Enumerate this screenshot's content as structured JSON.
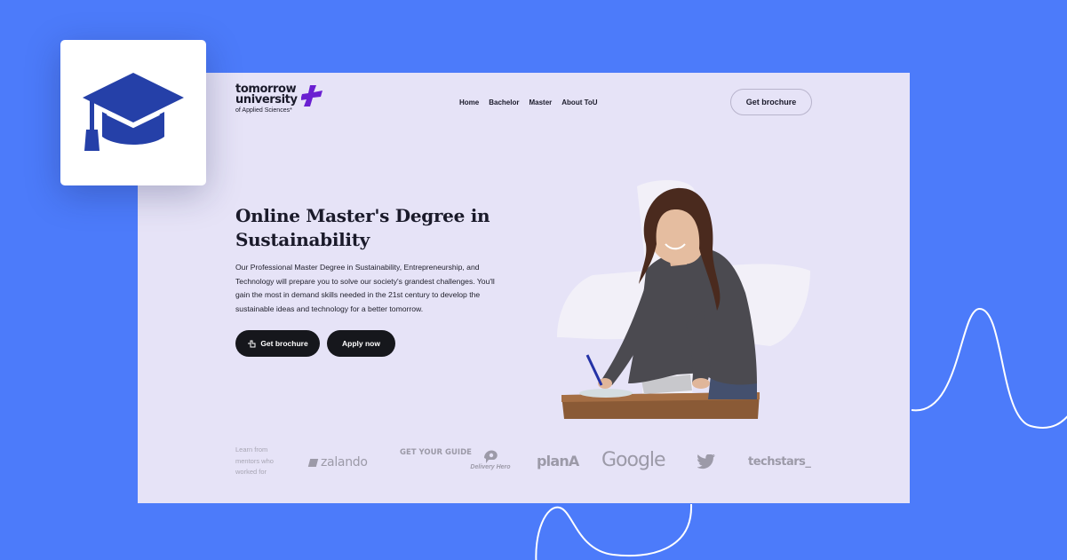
{
  "colors": {
    "background": "#4c7bfa",
    "page": "#e6e3f7",
    "accent": "#6a1fd1",
    "badge_icon": "#2540a8",
    "dark_button": "#16171c"
  },
  "badge": {
    "icon": "graduation-cap-icon"
  },
  "header": {
    "logo": {
      "line1": "tomorrow",
      "line2": "university",
      "line3": "of Applied Sciences*"
    },
    "nav": [
      "Home",
      "Bachelor",
      "Master",
      "About ToU"
    ],
    "cta_label": "Get brochure"
  },
  "hero": {
    "title": "Online Master's Degree in Sustainability",
    "description": "Our Professional Master Degree in Sustainability, Entrepreneurship, and Technology will prepare you to solve our society's grandest challenges. You'll gain the most in demand skills needed in the 21st century to develop the sustainable ideas and technology for a better tomorrow.",
    "primary_button": {
      "label": "Get brochure",
      "icon": "hand-pointer-icon"
    },
    "secondary_button": {
      "label": "Apply now"
    }
  },
  "mentors": {
    "label": "Learn from mentors who worked for",
    "brands": {
      "zalando": "zalando",
      "getyourguide": "GET YOUR GUIDE",
      "delivery_hero": "Delivery Hero",
      "plana": "planA",
      "google": "Google",
      "twitter": "twitter-bird-icon",
      "techstars": "techstars_"
    }
  }
}
